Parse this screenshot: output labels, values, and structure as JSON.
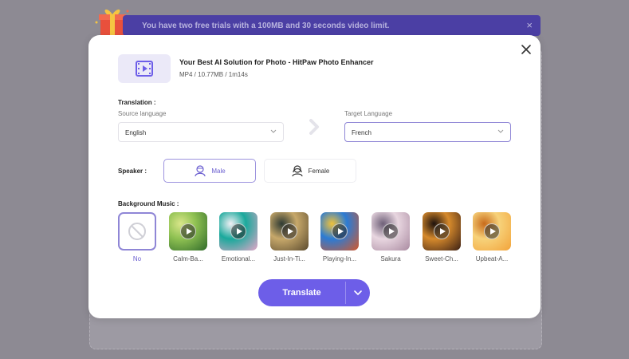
{
  "banner": {
    "message": "You have two free trials with a 100MB and 30 seconds video limit.",
    "close_glyph": "×"
  },
  "file": {
    "title": "Your Best AI Solution for Photo - HitPaw Photo Enhancer",
    "meta": "MP4 / 10.77MB / 1m14s",
    "icon": "video-file-icon"
  },
  "translation": {
    "heading": "Translation :",
    "source_label": "Source language",
    "source_value": "English",
    "target_label": "Target Language",
    "target_value": "French"
  },
  "speaker": {
    "heading": "Speaker :",
    "options": [
      {
        "label": "Male",
        "selected": true
      },
      {
        "label": "Female",
        "selected": false
      }
    ]
  },
  "music": {
    "heading": "Background Music :",
    "items": [
      {
        "name": "No",
        "selected": true
      },
      {
        "name": "Calm-Ba...",
        "colors": [
          "#2f6a2a",
          "#8fc152",
          "#d9e68a"
        ]
      },
      {
        "name": "Emotional...",
        "colors": [
          "#e6a6c9",
          "#1aa99c",
          "#f2f0f5"
        ]
      },
      {
        "name": "Just-In-Ti...",
        "colors": [
          "#5a4a2e",
          "#c7a86a",
          "#2e3a33"
        ]
      },
      {
        "name": "Playing-In...",
        "colors": [
          "#d4582b",
          "#2b7bd4",
          "#f0c23a"
        ]
      },
      {
        "name": "Sakura",
        "colors": [
          "#a98aa0",
          "#e8d6e0",
          "#6e6078"
        ]
      },
      {
        "name": "Sweet-Ch...",
        "colors": [
          "#3a1f14",
          "#d68a2c",
          "#1e120d"
        ]
      },
      {
        "name": "Upbeat-A...",
        "colors": [
          "#f2a33a",
          "#f7d27a",
          "#c86b1c"
        ]
      }
    ]
  },
  "actions": {
    "translate_label": "Translate"
  },
  "colors": {
    "accent": "#6d5ee8",
    "banner": "#4b3fa4"
  }
}
